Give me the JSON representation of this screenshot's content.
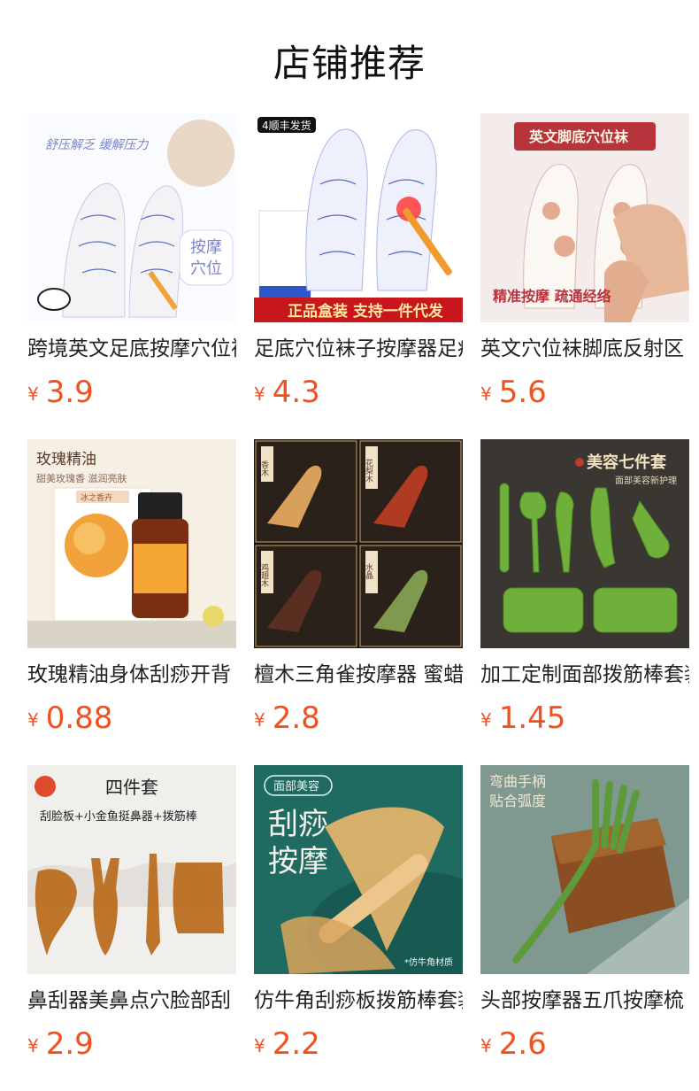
{
  "page": {
    "title": "店铺推荐"
  },
  "products": [
    {
      "name": "跨境英文足底按摩穴位袜",
      "currency": "¥",
      "price": "3.9",
      "image_text": [
        "舒压解乏  缓解压力",
        "按摩",
        "穴位"
      ]
    },
    {
      "name": "足底穴位袜子按摩器足疗",
      "currency": "¥",
      "price": "4.3",
      "image_text": [
        "4顺丰发货",
        "正品盒装  支持一件代发"
      ]
    },
    {
      "name": "英文穴位袜脚底反射区",
      "currency": "¥",
      "price": "5.6",
      "image_text": [
        "英文脚底穴位袜",
        "精准按摩  疏通经络"
      ]
    },
    {
      "name": "玫瑰精油身体刮痧开背",
      "currency": "¥",
      "price": "0.88",
      "image_text": [
        "玫瑰精油",
        "甜美玫瑰香  滋润亮肤",
        "冰之香卉"
      ]
    },
    {
      "name": "檀木三角雀按摩器 蜜蜡",
      "currency": "¥",
      "price": "2.8",
      "image_text": [
        "香木",
        "花梨木",
        "鸡翅木",
        "水晶"
      ]
    },
    {
      "name": "加工定制面部拨筋棒套装",
      "currency": "¥",
      "price": "1.45",
      "image_text": [
        "美容七件套",
        "面部美容新护理"
      ]
    },
    {
      "name": "鼻刮器美鼻点穴脸部刮",
      "currency": "¥",
      "price": "2.9",
      "image_text": [
        "四件套",
        "刮脸板+小金鱼挺鼻器+拨筋棒"
      ]
    },
    {
      "name": "仿牛角刮痧板拨筋棒套装",
      "currency": "¥",
      "price": "2.2",
      "image_text": [
        "面部美容",
        "刮痧",
        "按摩",
        "*仿牛角材质"
      ]
    },
    {
      "name": "头部按摩器五爪按摩梳",
      "currency": "¥",
      "price": "2.6",
      "image_text": [
        "弯曲手柄",
        "贴合弧度"
      ]
    }
  ]
}
